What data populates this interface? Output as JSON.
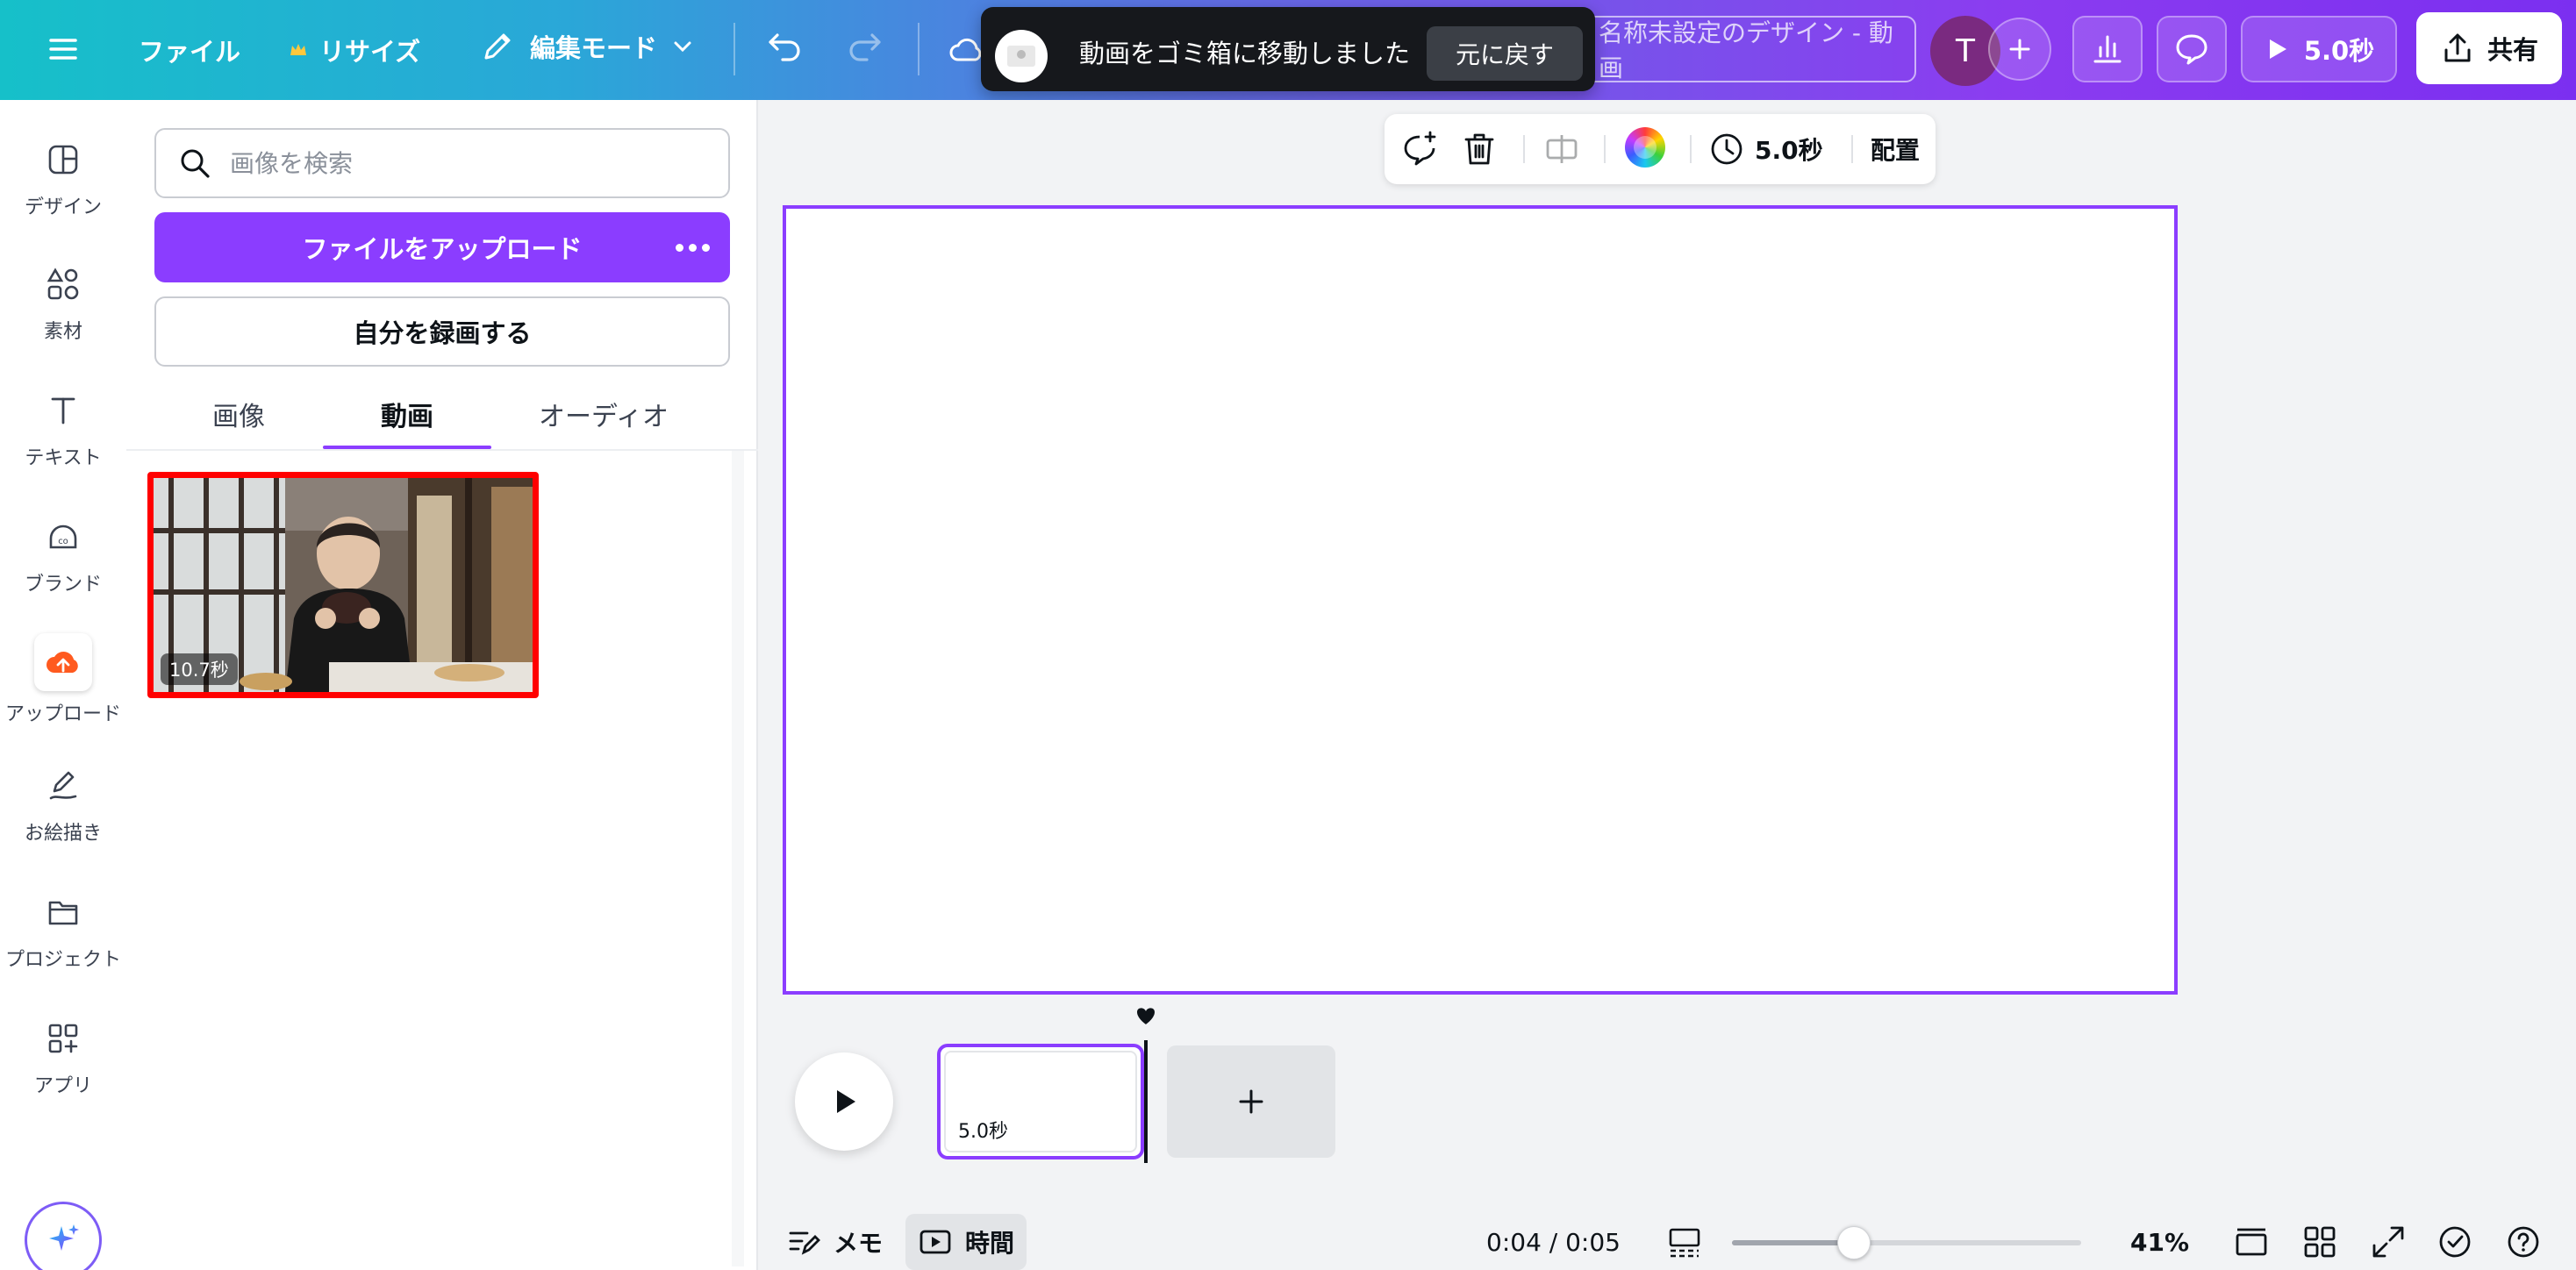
{
  "header": {
    "menu_label": "",
    "file_label": "ファイル",
    "resize_label": "リサイズ",
    "edit_mode_label": "編集モード",
    "design_title": "名称未設定のデザイン - 動画",
    "avatar_initial": "T",
    "play_duration": "5.0秒",
    "share_label": "共有",
    "accent_color": "#8b3dff"
  },
  "toast": {
    "message": "動画をゴミ箱に移動しました",
    "undo_label": "元に戻す"
  },
  "rail": {
    "items": [
      {
        "label": "デザイン",
        "icon": "layout-icon"
      },
      {
        "label": "素材",
        "icon": "elements-icon"
      },
      {
        "label": "テキスト",
        "icon": "text-icon"
      },
      {
        "label": "ブランド",
        "icon": "brand-icon"
      },
      {
        "label": "アップロード",
        "icon": "upload-cloud-icon"
      },
      {
        "label": "お絵描き",
        "icon": "draw-icon"
      },
      {
        "label": "プロジェクト",
        "icon": "folder-icon"
      },
      {
        "label": "アプリ",
        "icon": "apps-icon"
      }
    ]
  },
  "panel": {
    "search_placeholder": "画像を検索",
    "upload_label": "ファイルをアップロード",
    "record_label": "自分を録画する",
    "tabs": [
      {
        "label": "画像"
      },
      {
        "label": "動画"
      },
      {
        "label": "オーディオ"
      }
    ],
    "active_tab": "動画",
    "video": {
      "duration": "10.7秒"
    }
  },
  "context_toolbar": {
    "duration": "5.0秒",
    "arrange_label": "配置"
  },
  "timeline": {
    "clip_duration": "5.0秒"
  },
  "bottom_bar": {
    "notes_label": "メモ",
    "time_label": "時間",
    "timecode": "0:04 / 0:05",
    "zoom_level": "41%",
    "zoom_fraction": 0.35
  }
}
